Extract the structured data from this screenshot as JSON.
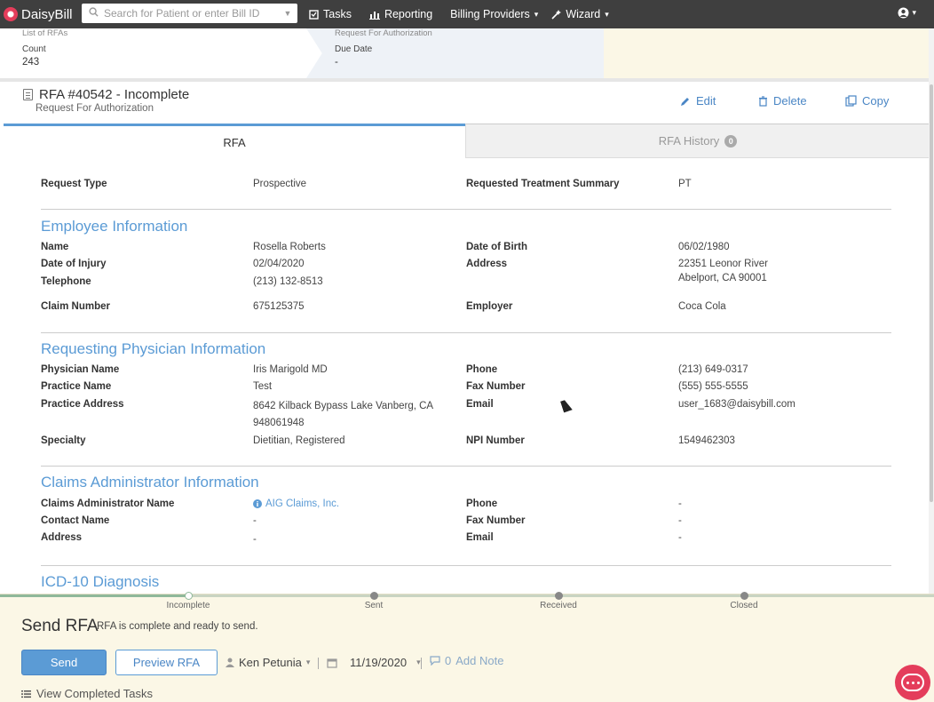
{
  "nav": {
    "app_name": "DaisyBill",
    "search_placeholder": "Search for Patient or enter Bill ID",
    "links": [
      {
        "label": "Tasks",
        "icon": "checklist-icon"
      },
      {
        "label": "Reporting",
        "icon": "bar-chart-icon"
      },
      {
        "label": "Billing Providers",
        "icon": "chevron-down-icon"
      },
      {
        "label": "Wizard",
        "icon": "wand-icon"
      }
    ]
  },
  "summary": {
    "list_label": "List of RFAs",
    "count_label": "Count",
    "count_value": "243",
    "request_label": "Request For Authorization",
    "due_label": "Due Date",
    "due_value": "-"
  },
  "header": {
    "title": "RFA #40542 - Incomplete",
    "subtitle": "Request For Authorization",
    "actions": {
      "edit": "Edit",
      "delete": "Delete",
      "copy": "Copy"
    }
  },
  "tabs": {
    "rfa": "RFA",
    "history": "RFA History",
    "history_count": "0"
  },
  "request": {
    "type_label": "Request Type",
    "type_value": "Prospective",
    "summary_label": "Requested Treatment Summary",
    "summary_value": "PT"
  },
  "employee": {
    "heading": "Employee Information",
    "name_label": "Name",
    "name_value": "Rosella Roberts",
    "dob_label": "Date of Birth",
    "dob_value": "06/02/1980",
    "doi_label": "Date of Injury",
    "doi_value": "02/04/2020",
    "address_label": "Address",
    "address_line1": "22351 Leonor River",
    "address_line2": "Abelport, CA 90001",
    "phone_label": "Telephone",
    "phone_value": "(213) 132-8513",
    "claim_label": "Claim Number",
    "claim_value": "675125375",
    "employer_label": "Employer",
    "employer_value": "Coca Cola"
  },
  "physician": {
    "heading": "Requesting Physician Information",
    "name_label": "Physician Name",
    "name_value": "Iris Marigold MD",
    "phone_label": "Phone",
    "phone_value": "(213) 649-0317",
    "practice_label": "Practice Name",
    "practice_value": "Test",
    "fax_label": "Fax Number",
    "fax_value": "(555) 555-5555",
    "paddress_label": "Practice Address",
    "paddress_line1": "8642 Kilback Bypass Lake Vanberg, CA",
    "paddress_line2": "948061948",
    "email_label": "Email",
    "email_value": "user_1683@daisybill.com",
    "specialty_label": "Specialty",
    "specialty_value": "Dietitian, Registered",
    "npi_label": "NPI Number",
    "npi_value": "1549462303"
  },
  "claims_admin": {
    "heading": "Claims Administrator Information",
    "name_label": "Claims Administrator Name",
    "name_value": "AIG Claims, Inc.",
    "phone_label": "Phone",
    "phone_value": "-",
    "contact_label": "Contact Name",
    "contact_value": "-",
    "fax_label": "Fax Number",
    "fax_value": "-",
    "address_label": "Address",
    "address_value": "-",
    "email_label": "Email",
    "email_value": "-"
  },
  "icd": {
    "heading": "ICD-10 Diagnosis"
  },
  "workflow": {
    "steps": [
      "Incomplete",
      "Sent",
      "Received",
      "Closed"
    ],
    "send_title": "Send RFA",
    "send_desc": "RFA is complete and ready to send.",
    "send_button": "Send",
    "preview_button": "Preview RFA",
    "assignee": "Ken Petunia",
    "date": "11/19/2020",
    "note_count": "0",
    "note_label": "Add Note",
    "view_completed": "View Completed Tasks"
  },
  "colors": {
    "accent": "#5b9bd5",
    "nav_bg": "#3f3f3f",
    "brand": "#e43d5b",
    "panel_bg": "#fbf7e6"
  }
}
